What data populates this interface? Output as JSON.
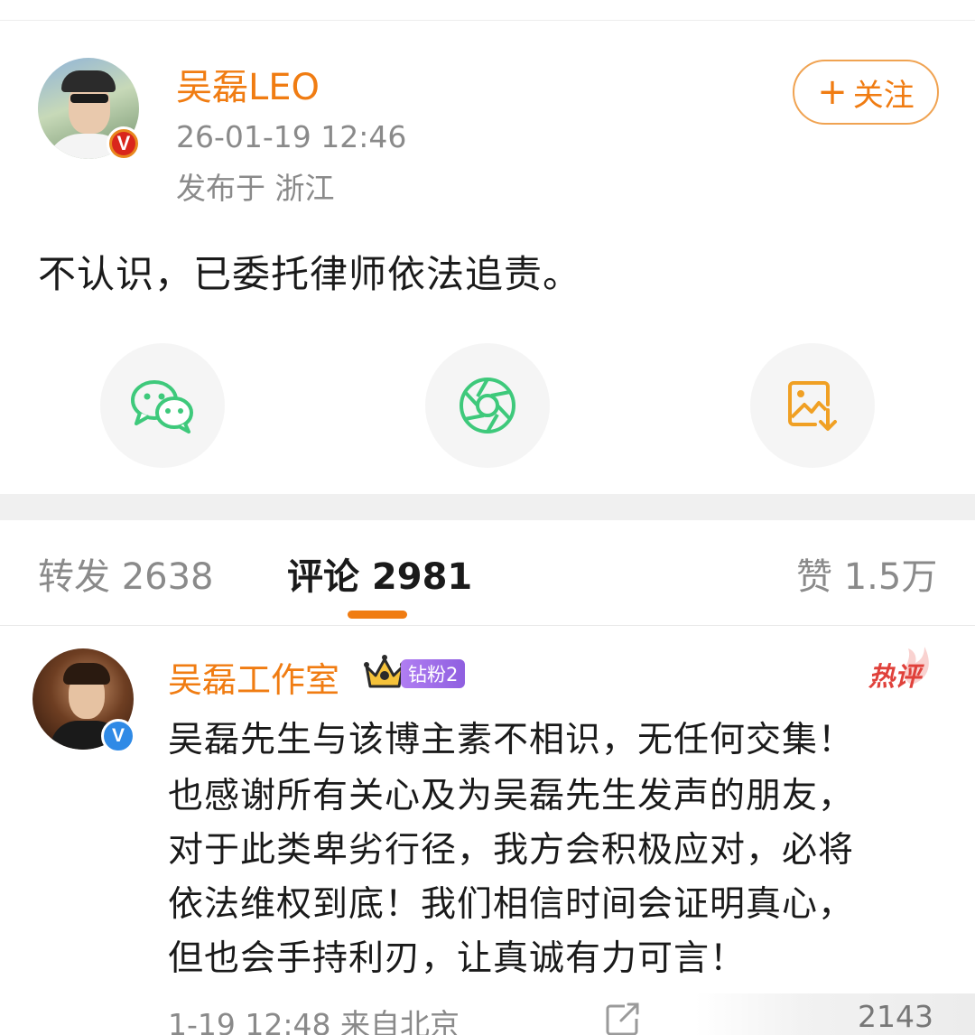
{
  "post": {
    "author": "吴磊LEO",
    "timestamp": "26-01-19 12:46",
    "location": "发布于 浙江",
    "follow_label": "关注",
    "text": "不认识，已委托律师依法追责。",
    "verified_badge": "V"
  },
  "share_actions": [
    {
      "icon": "wechat-icon"
    },
    {
      "icon": "moments-shutter-icon"
    },
    {
      "icon": "save-image-icon"
    }
  ],
  "tabs": {
    "repost": "转发 2638",
    "comments": "评论 2981",
    "likes": "赞 1.5万"
  },
  "comment": {
    "author": "吴磊工作室",
    "fan_badge": "钻粉2",
    "hot_label": "热评",
    "verified_badge": "V",
    "lines": [
      "吴磊先生与该博主素不相识，无任何交集！",
      "也感谢所有关心及为吴磊先生发声的朋友，",
      "对于此类卑劣行径，我方会积极应对，必将",
      "依法维权到底！我们相信时间会证明真心，",
      "但也会手持利刃，让真诚有力可言！"
    ],
    "meta": "1-19 12:48 来自北京",
    "like_count": "2143"
  },
  "colors": {
    "accent": "#f07c12",
    "wechat_green": "#3ec97b",
    "hot_red": "#e0413b"
  }
}
